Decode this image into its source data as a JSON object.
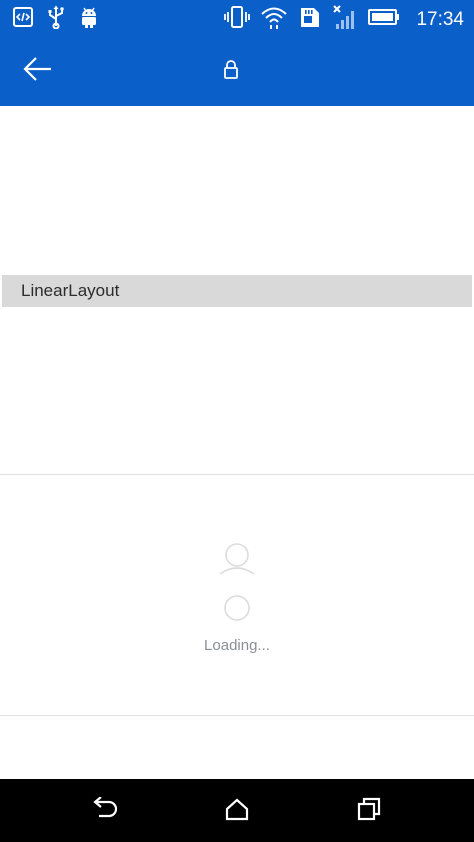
{
  "status_bar": {
    "time": "17:34",
    "icons": [
      "code-icon",
      "usb-icon",
      "android-icon",
      "vibrate-icon",
      "wifi-icon",
      "sd-card-icon",
      "signal-icon",
      "battery-icon"
    ]
  },
  "app_bar": {
    "icons": [
      "back-arrow-icon",
      "lock-icon"
    ],
    "color": "#0a5fc8"
  },
  "content": {
    "linear_layout_label": "LinearLayout",
    "loading_text": "Loading..."
  },
  "nav_bar": {
    "icons": [
      "nav-back-icon",
      "home-icon",
      "recents-icon"
    ]
  }
}
